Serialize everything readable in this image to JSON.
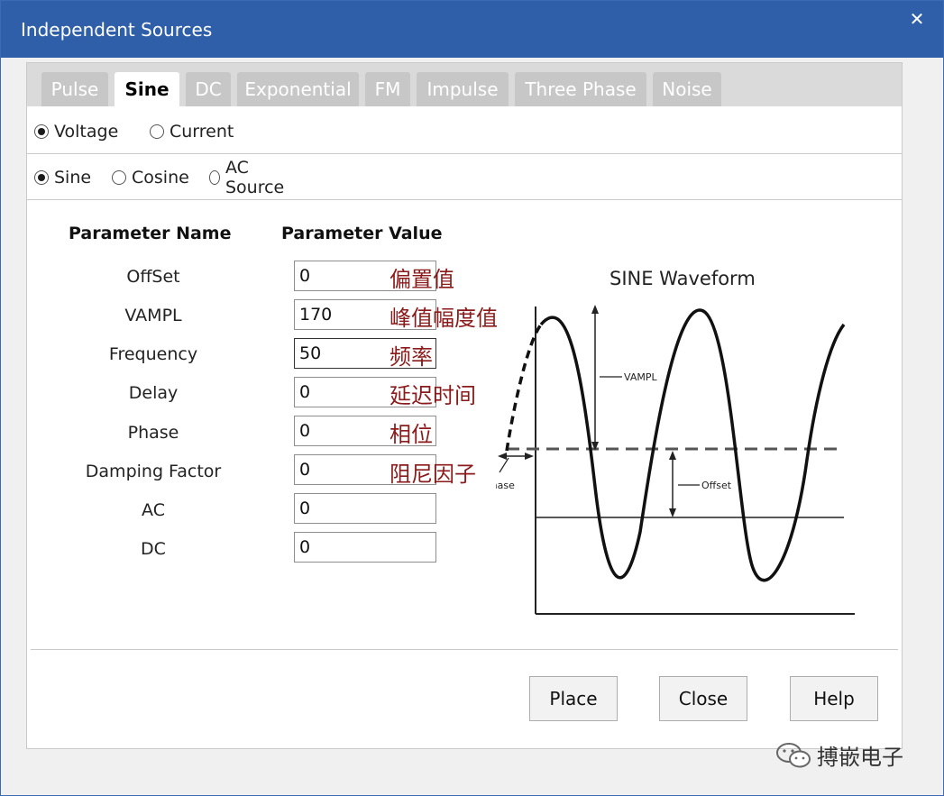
{
  "window": {
    "title": "Independent Sources",
    "close_glyph": "✕"
  },
  "tabs": [
    {
      "label": "Pulse",
      "active": false
    },
    {
      "label": "Sine",
      "active": true
    },
    {
      "label": "DC",
      "active": false
    },
    {
      "label": "Exponential",
      "active": false
    },
    {
      "label": "FM",
      "active": false
    },
    {
      "label": "Impulse",
      "active": false
    },
    {
      "label": "Three Phase",
      "active": false
    },
    {
      "label": "Noise",
      "active": false
    }
  ],
  "source_type": {
    "options": [
      {
        "label": "Voltage",
        "selected": true
      },
      {
        "label": "Current",
        "selected": false
      }
    ]
  },
  "waveform_type": {
    "options": [
      {
        "label": "Sine",
        "selected": true
      },
      {
        "label": "Cosine",
        "selected": false
      },
      {
        "label": "AC Source",
        "selected": false
      }
    ]
  },
  "params": {
    "header_name": "Parameter Name",
    "header_value": "Parameter Value",
    "rows": [
      {
        "name": "OffSet",
        "value": "0",
        "annotation": "偏置值"
      },
      {
        "name": "VAMPL",
        "value": "170",
        "annotation": "峰值幅度值"
      },
      {
        "name": "Frequency",
        "value": "50",
        "annotation": "频率"
      },
      {
        "name": "Delay",
        "value": "0",
        "annotation": "延迟时间"
      },
      {
        "name": "Phase",
        "value": "0",
        "annotation": "相位"
      },
      {
        "name": "Damping Factor",
        "value": "0",
        "annotation": "阻尼因子"
      },
      {
        "name": "AC",
        "value": "0",
        "annotation": ""
      },
      {
        "name": "DC",
        "value": "0",
        "annotation": ""
      }
    ]
  },
  "diagram": {
    "title": "SINE Waveform",
    "label_vampl": "VAMPL",
    "label_offset": "Offset",
    "label_phase": "Phase"
  },
  "buttons": {
    "place": "Place",
    "close": "Close",
    "help": "Help"
  },
  "watermark": {
    "text": "搏嵌电子",
    "icon": "wechat-icon"
  },
  "colors": {
    "titlebar": "#2f5fa8",
    "annotation": "#8b1b1b"
  }
}
